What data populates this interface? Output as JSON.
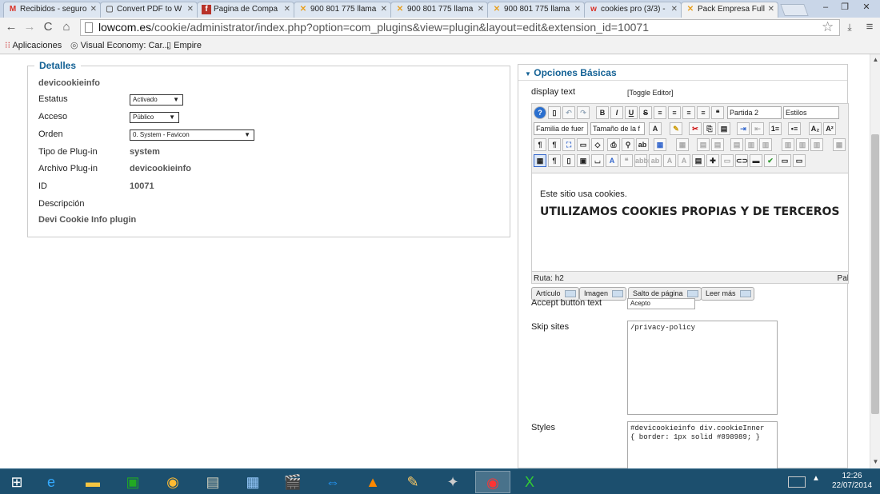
{
  "browser": {
    "tabs": [
      {
        "label": "Recibidos - seguro",
        "icon": "M",
        "icon_color": "#d93025"
      },
      {
        "label": "Convert PDF to W",
        "icon": "▢",
        "icon_color": "#666"
      },
      {
        "label": "Pagina de Compa",
        "icon": "f",
        "icon_color": "#fff"
      },
      {
        "label": "900 801 775 llama",
        "icon": "✕",
        "icon_color": "#e8a020"
      },
      {
        "label": "900 801 775 llama",
        "icon": "✕",
        "icon_color": "#e8a020"
      },
      {
        "label": "900 801 775 llama",
        "icon": "✕",
        "icon_color": "#e8a020"
      },
      {
        "label": "cookies pro (3/3) -",
        "icon": "w",
        "icon_color": "#d93025"
      },
      {
        "label": "Pack Empresa Full",
        "icon": "✕",
        "icon_color": "#e8a020"
      }
    ],
    "url_host": "lowcom.es",
    "url_path": "/cookie/administrator/index.php?option=com_plugins&view=plugin&layout=edit&extension_id=10071",
    "bookmarks": [
      "Aplicaciones",
      "Visual Economy: Car...",
      "Empire"
    ]
  },
  "details": {
    "legend": "Detalles",
    "name": "devicookieinfo",
    "estatus_label": "Estatus",
    "estatus_value": "Activado",
    "acceso_label": "Acceso",
    "acceso_value": "Público",
    "orden_label": "Orden",
    "orden_value": "0. System - Favicon",
    "tipo_label": "Tipo de Plug-in",
    "tipo_value": "system",
    "archivo_label": "Archivo Plug-in",
    "archivo_value": "devicookieinfo",
    "id_label": "ID",
    "id_value": "10071",
    "descripcion_label": "Descripción",
    "descripcion_value": "Devi Cookie Info plugin"
  },
  "options": {
    "header": "Opciones Básicas",
    "display_text_label": "display text",
    "toggle_editor": "[Toggle Editor]",
    "format_select": "Partida 2",
    "styles_select": "Estilos",
    "font_family_select": "Familia de fuer",
    "font_size_select": "Tamaño de la f",
    "editor_paragraph": "Este sitio usa cookies.",
    "editor_heading": "UTILIZAMOS COOKIES PROPIAS Y DE TERCEROS",
    "path_label": "Ruta:",
    "path_value": "h2",
    "word_count_label": "Pal",
    "btn_articulo": "Artículo",
    "btn_imagen": "Imagen",
    "btn_salto": "Salto de página",
    "btn_leer": "Leer más",
    "accept_label": "Accept button text",
    "accept_value": "Acepto",
    "skip_label": "Skip sites",
    "skip_value": "/privacy-policy",
    "styles_label": "Styles",
    "styles_value": "#devicookieinfo div.cookieInner\n{ border: 1px solid #898989; }"
  },
  "taskbar": {
    "time": "12:26",
    "date": "22/07/2014"
  }
}
